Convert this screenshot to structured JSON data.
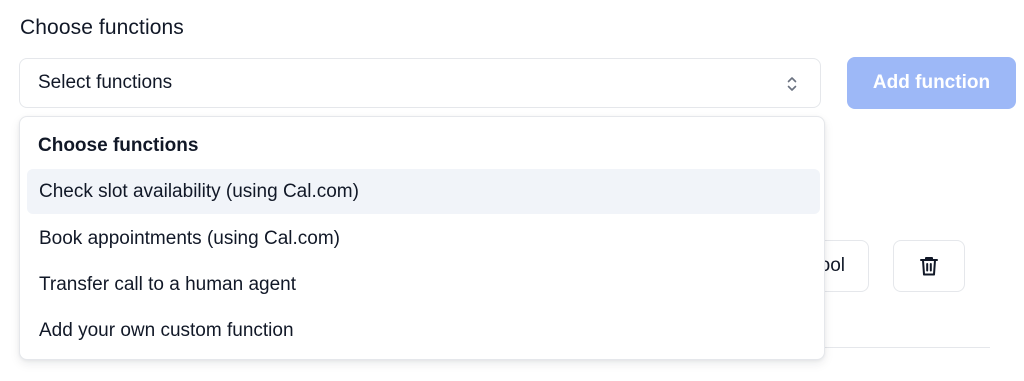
{
  "section": {
    "title": "Choose functions"
  },
  "select": {
    "value": "Select functions",
    "chevron_icon": "chevron-up-down-icon"
  },
  "add_button": {
    "label": "Add function",
    "color": "#9db8f7"
  },
  "dropdown": {
    "header": "Choose functions",
    "highlight_color": "#f1f4f9",
    "options": [
      {
        "label": "Check slot availability (using Cal.com)",
        "highlighted": true
      },
      {
        "label": "Book appointments (using Cal.com)",
        "highlighted": false
      },
      {
        "label": "Transfer call to a human agent",
        "highlighted": false
      },
      {
        "label": "Add your own custom function",
        "highlighted": false
      }
    ]
  },
  "background": {
    "tool_button_label": "ool",
    "delete_icon": "trash-icon"
  }
}
